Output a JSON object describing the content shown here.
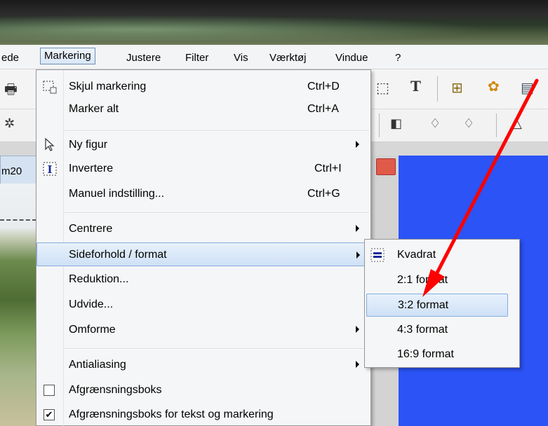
{
  "menubar": {
    "items": [
      "ede",
      "Markering",
      "Justere",
      "Filter",
      "Vis",
      "Værktøj",
      "Vindue",
      "?"
    ]
  },
  "document": {
    "tab_label": "m20"
  },
  "menu": {
    "items": [
      {
        "label": "Skjul markering",
        "shortcut": "Ctrl+D",
        "icon": "selection-rect-icon"
      },
      {
        "label": "Marker alt",
        "shortcut": "Ctrl+A"
      },
      {
        "label": "Ny figur",
        "icon": "arrow-cursor-icon",
        "submenu": true
      },
      {
        "label": "Invertere",
        "shortcut": "Ctrl+I",
        "icon": "invert-selection-icon"
      },
      {
        "label": "Manuel indstilling...",
        "shortcut": "Ctrl+G"
      },
      {
        "label": "Centrere",
        "submenu": true
      },
      {
        "label": "Sideforhold / format",
        "submenu": true,
        "highlighted": true
      },
      {
        "label": "Reduktion..."
      },
      {
        "label": "Udvide..."
      },
      {
        "label": "Omforme",
        "submenu": true
      },
      {
        "label": "Antialiasing",
        "submenu": true
      },
      {
        "label": "Afgrænsningsboks",
        "checked": false
      },
      {
        "label": "Afgrænsningsboks for tekst og markering",
        "checked": true
      }
    ]
  },
  "submenu": {
    "items": [
      {
        "label": "Kvadrat",
        "icon": "equals-icon"
      },
      {
        "label": "2:1 format"
      },
      {
        "label": "3:2 format",
        "highlighted": true
      },
      {
        "label": "4:3 format"
      },
      {
        "label": "16:9 format"
      }
    ]
  },
  "colors": {
    "highlight_border": "#84acdd",
    "canvas_blue": "#2b53f5",
    "annotation_red": "#ff0000"
  }
}
